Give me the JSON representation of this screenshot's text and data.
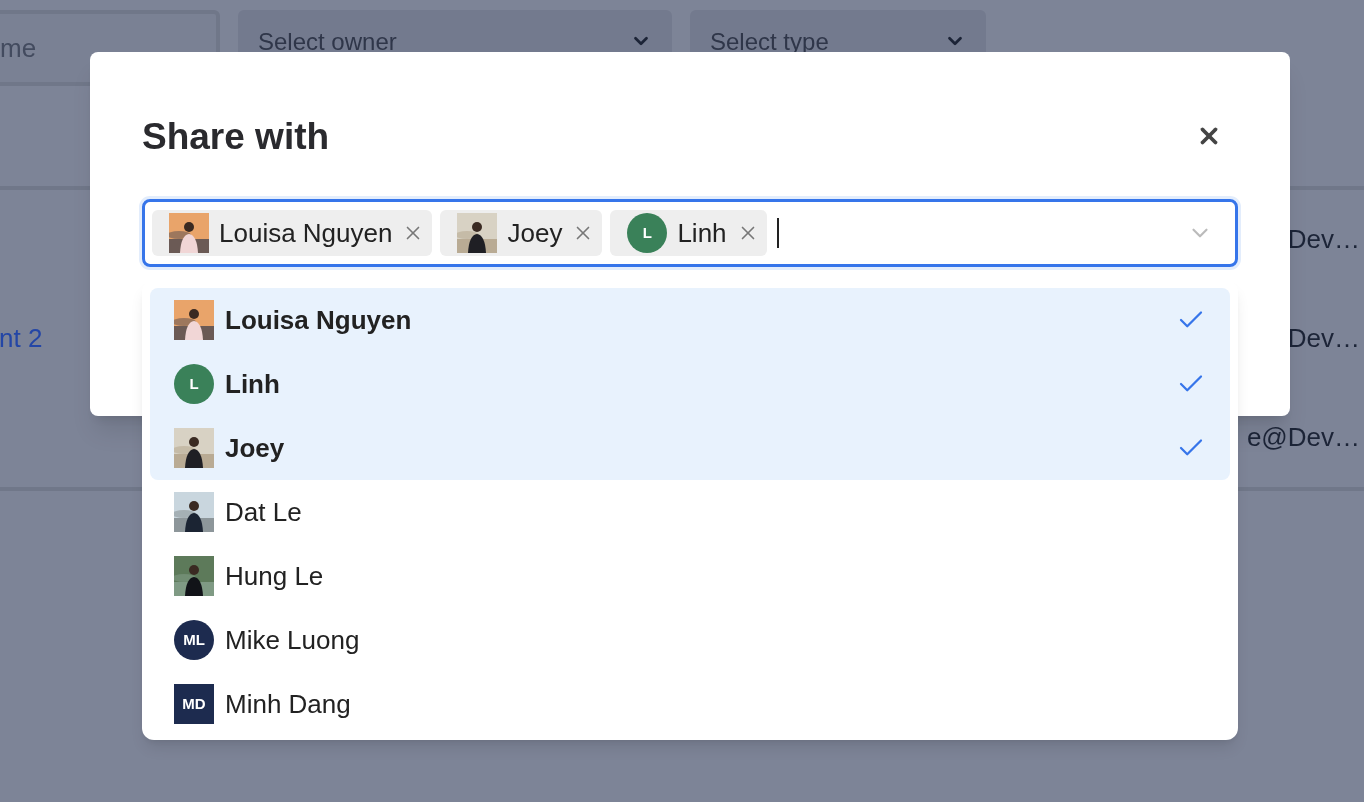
{
  "background": {
    "name_field": {
      "placeholder": "me"
    },
    "owner_select": {
      "placeholder": "Select owner"
    },
    "type_select": {
      "placeholder": "Select type"
    },
    "rows": [
      {
        "email": "Dev…"
      },
      {
        "name": "nt 2",
        "email": "Dev…"
      },
      {
        "email": "e@Dev…"
      }
    ]
  },
  "dialog": {
    "title": "Share with",
    "select": {
      "focused": true,
      "chips": [
        {
          "name": "Louisa Nguyen"
        },
        {
          "name": "Joey"
        },
        {
          "name": "Linh",
          "avatar": {
            "kind": "circle",
            "initials": "L",
            "color": "#3a8159"
          }
        }
      ]
    },
    "options": [
      {
        "name": "Louisa Nguyen",
        "selected": true
      },
      {
        "name": "Linh",
        "selected": true,
        "avatar": {
          "kind": "circle",
          "initials": "L",
          "color": "#3a8159"
        }
      },
      {
        "name": "Joey",
        "selected": true
      },
      {
        "name": "Dat Le",
        "selected": false
      },
      {
        "name": "Hung Le",
        "selected": false
      },
      {
        "name": "Mike Luong",
        "selected": false,
        "avatar": {
          "kind": "circle",
          "initials": "ML",
          "color": "#1d2b4f"
        }
      },
      {
        "name": "Minh Dang",
        "selected": false,
        "avatar": {
          "kind": "square",
          "initials": "MD",
          "color": "#1d2b4f"
        }
      }
    ]
  }
}
